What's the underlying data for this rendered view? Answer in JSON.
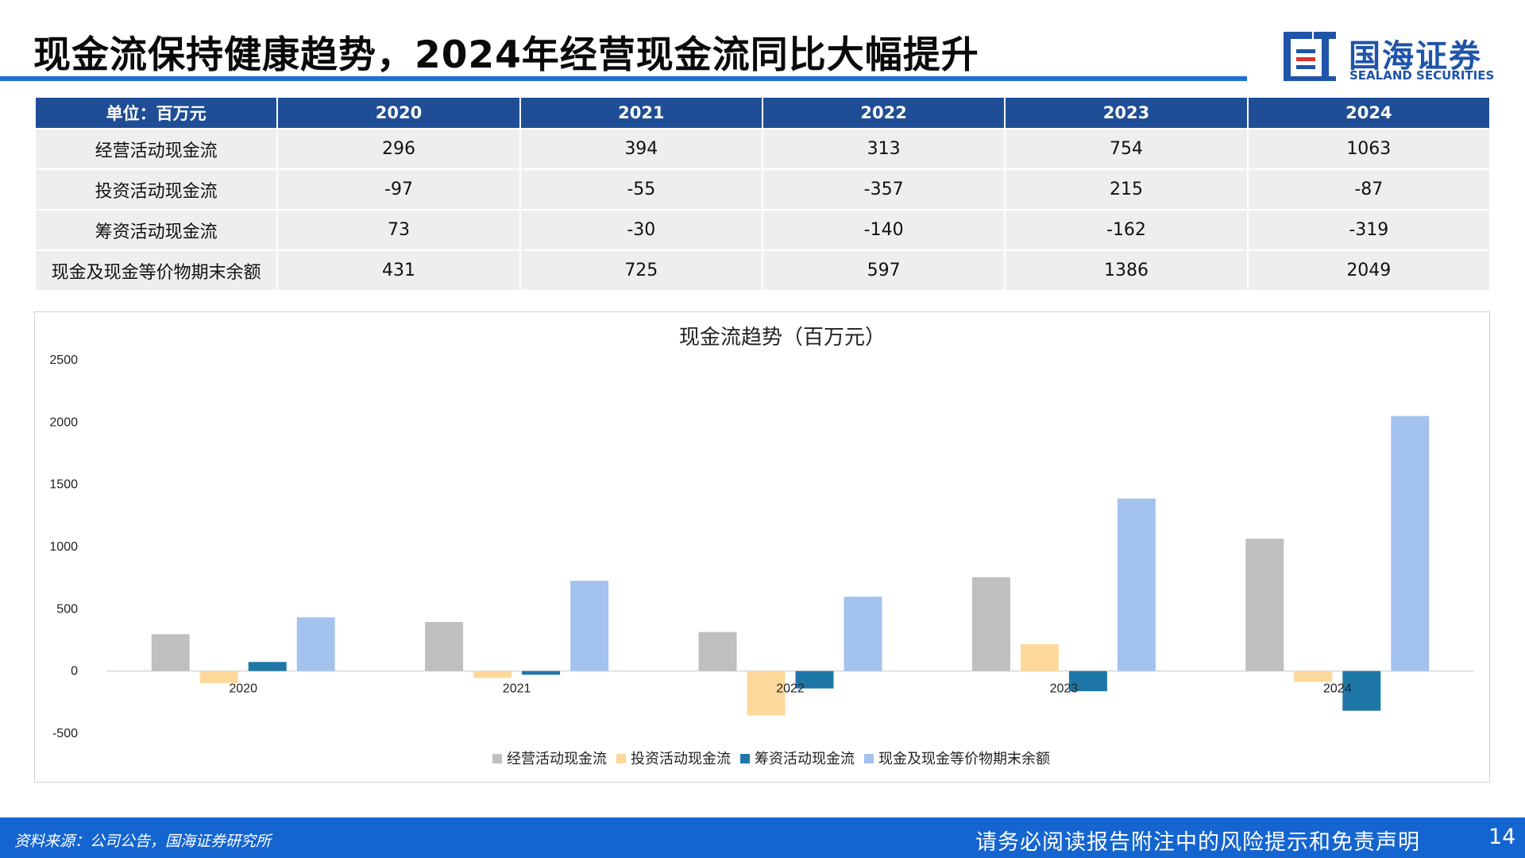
{
  "header": {
    "title": "现金流保持健康趋势，2024年经营现金流同比大幅提升",
    "logo_cn": "国海证券",
    "logo_en": "SEALAND SECURITIES"
  },
  "table": {
    "columns": [
      "单位：百万元",
      "2020",
      "2021",
      "2022",
      "2023",
      "2024"
    ],
    "rows": [
      [
        "经营活动现金流",
        "296",
        "394",
        "313",
        "754",
        "1063"
      ],
      [
        "投资活动现金流",
        "-97",
        "-55",
        "-357",
        "215",
        "-87"
      ],
      [
        "筹资活动现金流",
        "73",
        "-30",
        "-140",
        "-162",
        "-319"
      ],
      [
        "现金及现金等价物期末余额",
        "431",
        "725",
        "597",
        "1386",
        "2049"
      ]
    ]
  },
  "chart_data": {
    "type": "bar",
    "title": "现金流趋势（百万元）",
    "xlabel": "",
    "ylabel": "",
    "categories": [
      "2020",
      "2021",
      "2022",
      "2023",
      "2024"
    ],
    "series": [
      {
        "name": "经营活动现金流",
        "values": [
          296,
          394,
          313,
          754,
          1063
        ],
        "color": "#bfbfbf"
      },
      {
        "name": "投资活动现金流",
        "values": [
          -97,
          -55,
          -357,
          215,
          -87
        ],
        "color": "#fdd89b"
      },
      {
        "name": "筹资活动现金流",
        "values": [
          73,
          -30,
          -140,
          -162,
          -319
        ],
        "color": "#1f77a8"
      },
      {
        "name": "现金及现金等价物期末余额",
        "values": [
          431,
          725,
          597,
          1386,
          2049
        ],
        "color": "#a4c2ee"
      }
    ],
    "ylim": [
      -500,
      2500
    ],
    "yticks": [
      "2500",
      "2000",
      "1500",
      "1000",
      "500",
      "0",
      "-500"
    ],
    "grid": false,
    "legend": "bottom"
  },
  "footer": {
    "source": "资料来源：公司公告，国海证券研究所",
    "disclaimer": "请务必阅读报告附注中的风险提示和免责声明",
    "page": "14"
  },
  "colors": {
    "accent": "#1d6fd0",
    "table_header": "#1f4e96",
    "footer": "#1565d0"
  }
}
